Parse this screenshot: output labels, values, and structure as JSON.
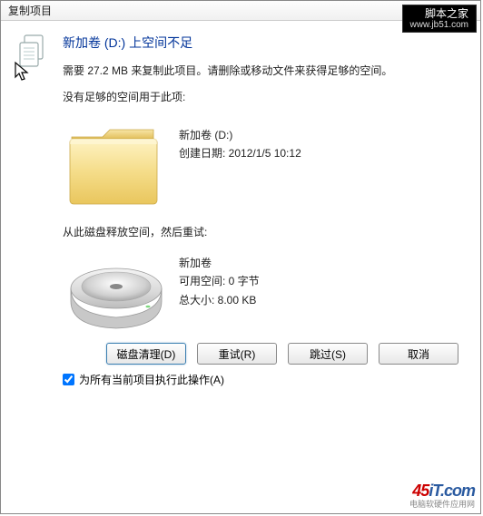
{
  "window": {
    "title": "复制项目"
  },
  "heading": "新加卷 (D:) 上空间不足",
  "message": "需要 27.2 MB 来复制此项目。请删除或移动文件来获得足够的空间。",
  "section_no_space": "没有足够的空间用于此项:",
  "folder": {
    "name": "新加卷 (D:)",
    "created_label": "创建日期: 2012/1/5 10:12"
  },
  "section_free_space": "从此磁盘释放空间，然后重试:",
  "drive": {
    "name": "新加卷",
    "free_label": "可用空间: 0 字节",
    "total_label": "总大小: 8.00 KB"
  },
  "buttons": {
    "cleanup": "磁盘清理(D)",
    "retry": "重试(R)",
    "skip": "跳过(S)",
    "cancel": "取消"
  },
  "checkbox_label": "为所有当前项目执行此操作(A)",
  "watermark_top": {
    "name": "脚本之家",
    "url": "www.jb51.com"
  },
  "watermark_bottom": {
    "brand_prefix": "45",
    "brand_suffix": "iT.com",
    "tag": "电脑软硬件应用网"
  }
}
